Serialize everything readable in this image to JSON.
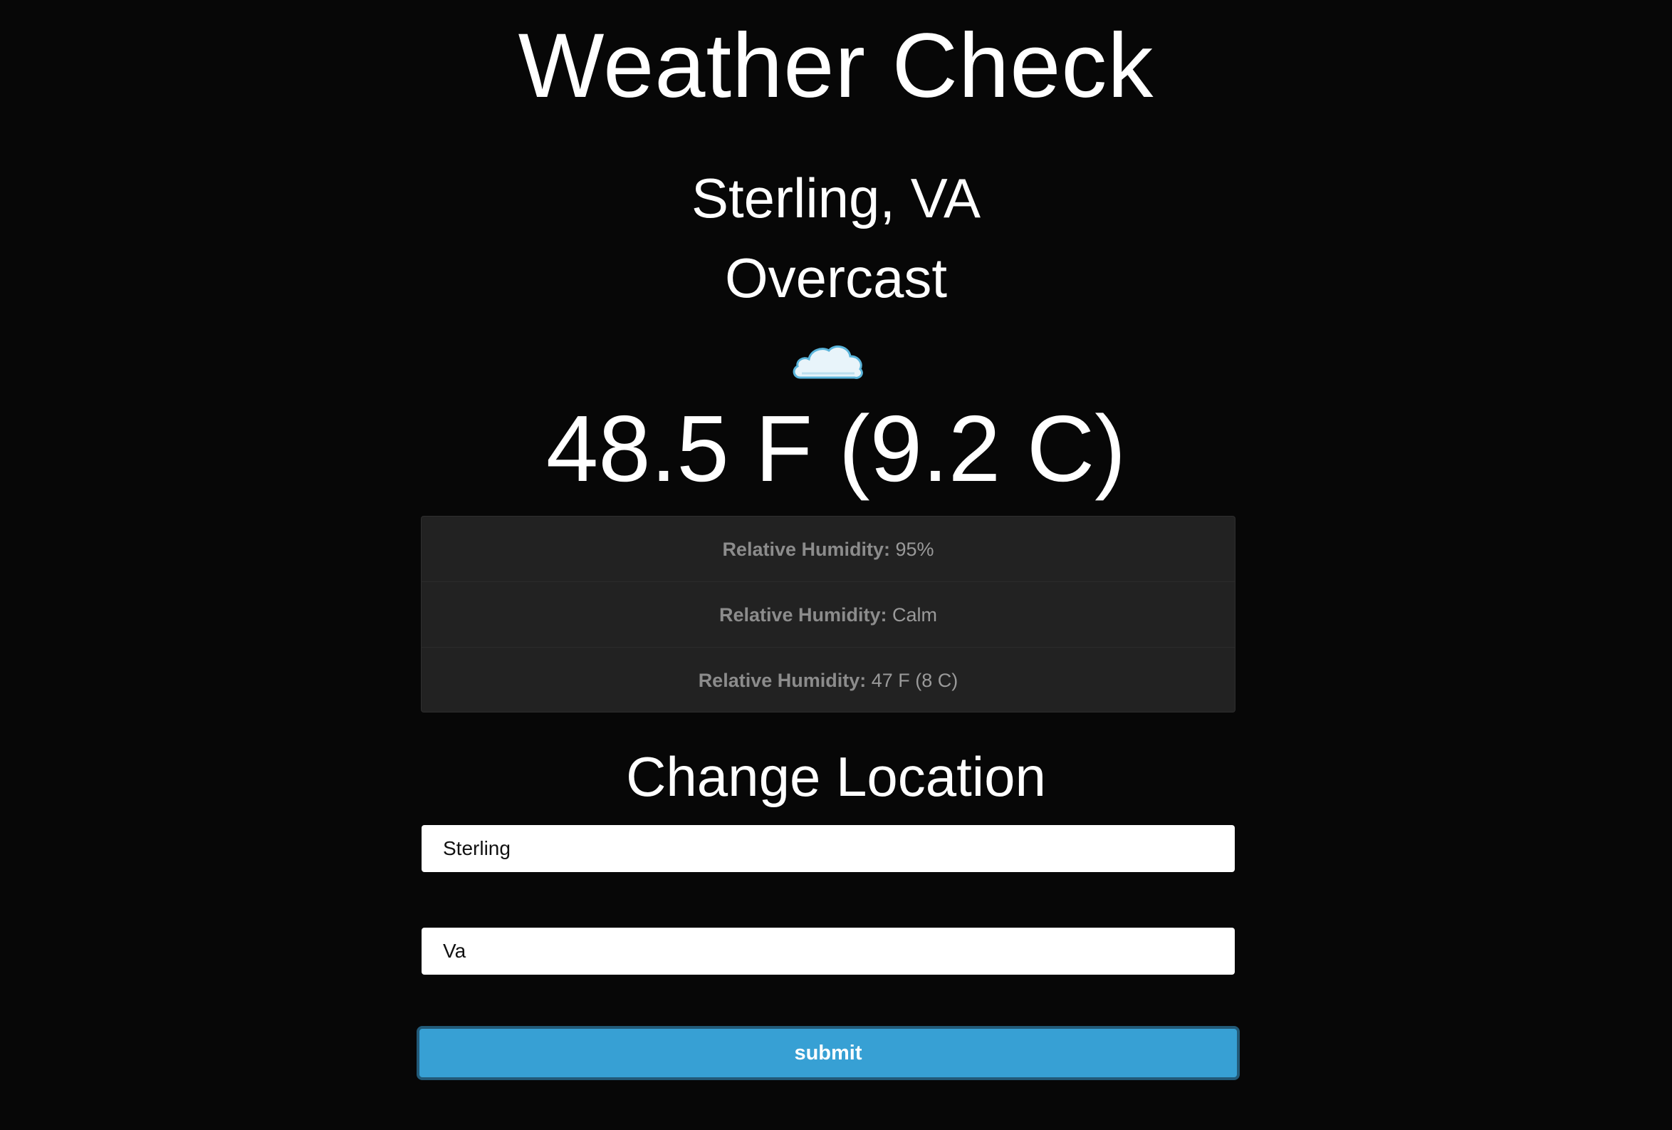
{
  "header": {
    "title": "Weather Check"
  },
  "current": {
    "location": "Sterling, VA",
    "condition": "Overcast",
    "icon": "cloud-icon",
    "temperature": "48.5 F (9.2 C)"
  },
  "details": [
    {
      "label": "Relative Humidity:",
      "value": "95%"
    },
    {
      "label": "Relative Humidity:",
      "value": "Calm"
    },
    {
      "label": "Relative Humidity:",
      "value": "47 F (8 C)"
    }
  ],
  "form": {
    "heading": "Change Location",
    "city_value": "Sterling",
    "state_value": "Va",
    "submit_label": "submit"
  },
  "colors": {
    "background": "#070707",
    "panel": "#222222",
    "accent": "#37a0d4",
    "accent_border": "#225a78"
  }
}
